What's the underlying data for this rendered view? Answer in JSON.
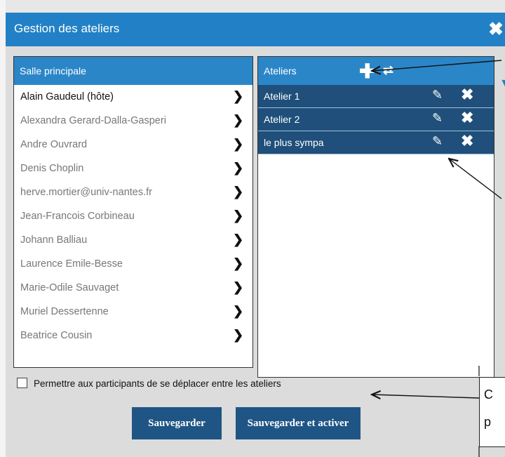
{
  "dialog": {
    "title": "Gestion des ateliers"
  },
  "main_room": {
    "header": "Salle principale",
    "participants": [
      {
        "name": "Alain Gaudeul (hôte)",
        "host": true
      },
      {
        "name": "Alexandra Gerard-Dalla-Gasperi",
        "host": false
      },
      {
        "name": "Andre Ouvrard",
        "host": false
      },
      {
        "name": "Denis Choplin",
        "host": false
      },
      {
        "name": "herve.mortier@univ-nantes.fr",
        "host": false
      },
      {
        "name": "Jean-Francois Corbineau",
        "host": false
      },
      {
        "name": "Johann Balliau",
        "host": false
      },
      {
        "name": "Laurence Emile-Besse",
        "host": false
      },
      {
        "name": "Marie-Odile Sauvaget",
        "host": false
      },
      {
        "name": "Muriel Dessertenne",
        "host": false
      },
      {
        "name": "Beatrice Cousin",
        "host": false
      }
    ]
  },
  "workshops": {
    "header": "Ateliers",
    "items": [
      {
        "name": "Atelier 1"
      },
      {
        "name": "Atelier 2"
      },
      {
        "name": "le plus sympa"
      }
    ]
  },
  "options": {
    "allow_move_label": "Permettre aux participants de se déplacer entre les ateliers",
    "allow_move_checked": false
  },
  "buttons": {
    "save": "Sauvegarder",
    "save_activate": "Sauvegarder et activer"
  },
  "callout": {
    "line1": "C",
    "line2": "p"
  },
  "colors": {
    "titlebar": "#2281c6",
    "panel_header": "#2b86c8",
    "workshop_row": "#1f4f7a",
    "button": "#1f5585"
  },
  "icons": {
    "close": "close-icon",
    "move": "chevron-right-icon",
    "add": "plus-icon",
    "shuffle": "shuffle-icon",
    "edit": "pencil-icon",
    "delete": "delete-icon"
  }
}
